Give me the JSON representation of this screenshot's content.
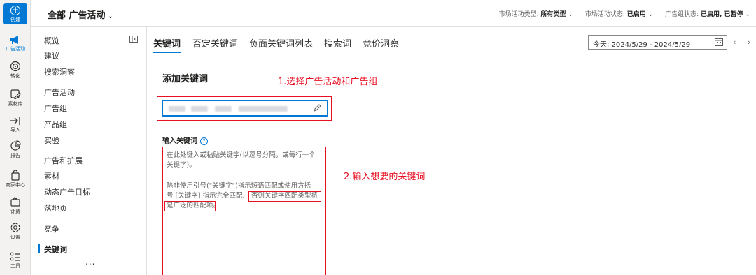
{
  "rail": {
    "create": "创建",
    "items": [
      {
        "label": "广告活动",
        "icon": "megaphone-icon",
        "active": true
      },
      {
        "label": "转化",
        "icon": "target-icon"
      },
      {
        "label": "素材库",
        "icon": "image-edit-icon"
      },
      {
        "label": "导入",
        "icon": "import-icon"
      },
      {
        "label": "报告",
        "icon": "report-icon"
      },
      {
        "label": "商家中心",
        "icon": "store-icon"
      },
      {
        "label": "计费",
        "icon": "billing-icon"
      },
      {
        "label": "设置",
        "icon": "gear-icon"
      },
      {
        "label": "工具",
        "icon": "tools-icon"
      }
    ]
  },
  "topbar": {
    "scope": "全部 广告活动",
    "filters": [
      {
        "label": "市场活动类型:",
        "value": "所有类型"
      },
      {
        "label": "市场活动状态:",
        "value": "已启用"
      },
      {
        "label": "广告组状态:",
        "value": "已启用, 已暂停"
      }
    ]
  },
  "nav": {
    "items": [
      {
        "label": "概览"
      },
      {
        "label": "建议"
      },
      {
        "label": "搜索洞察"
      },
      {
        "label": "广告活动"
      },
      {
        "label": "广告组"
      },
      {
        "label": "产品组"
      },
      {
        "label": "实验"
      },
      {
        "label": "广告和扩展"
      },
      {
        "label": "素材"
      },
      {
        "label": "动态广告目标"
      },
      {
        "label": "落地页"
      },
      {
        "label": "竞争"
      },
      {
        "label": "关键词",
        "active": true
      }
    ],
    "more": "..."
  },
  "tabs": [
    {
      "label": "关键词",
      "active": true
    },
    {
      "label": "否定关键词"
    },
    {
      "label": "负面关键词列表"
    },
    {
      "label": "搜索词"
    },
    {
      "label": "竞价洞察"
    }
  ],
  "date_range": "今天: 2024/5/29 - 2024/5/29",
  "add_keywords": {
    "title": "添加关键词",
    "annotation_1": "1.选择广告活动和广告组",
    "input_label": "输入关键词",
    "placeholder_line1": "在此处键入或粘贴关键字(以逗号分隔，或每行一个",
    "placeholder_line2": "关键字)。",
    "placeholder_line3": "除非使用引号(\"关键字\")指示短语匹配或使用方括",
    "placeholder_line4a": "号 [关键字] 指示完全匹配,",
    "placeholder_line4b": "否则关键字匹配类型将",
    "placeholder_line5a": "是广泛的匹配项",
    "placeholder_line5b": "。",
    "annotation_2": "2.输入想要的关键词"
  },
  "colors": {
    "accent": "#0078d4",
    "annotation": "#e81123"
  }
}
